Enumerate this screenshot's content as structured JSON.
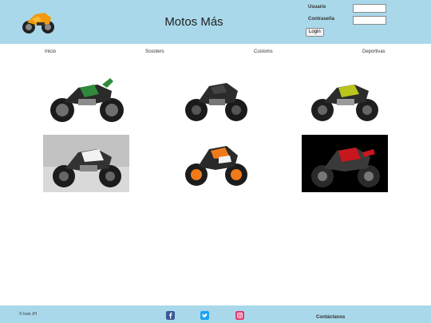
{
  "header": {
    "title": "Motos Más",
    "logo_icon": "orange-sport-motorcycle-logo",
    "login": {
      "user_label": "Usuario",
      "password_label": "Contraseña",
      "user_value": "",
      "password_value": "",
      "button_label": "Login"
    }
  },
  "nav": {
    "items": [
      {
        "label": "Inicio"
      },
      {
        "label": "Scooters"
      },
      {
        "label": "Customs"
      },
      {
        "label": "Deportivas"
      }
    ]
  },
  "gallery": {
    "items": [
      {
        "name": "green-naked-motorcycle",
        "accent": "#2f8a3c"
      },
      {
        "name": "black-naked-motorcycle",
        "accent": "#2b2b2b"
      },
      {
        "name": "lime-naked-motorcycle",
        "accent": "#b9c41c"
      },
      {
        "name": "white-naked-motorcycle",
        "accent": "#e6e6e6"
      },
      {
        "name": "orange-white-sport-motorcycle",
        "accent": "#f07a1a"
      },
      {
        "name": "red-supermoto-motorcycle",
        "accent": "#c8161d"
      }
    ]
  },
  "footer": {
    "copyright": "© Ivan JH",
    "contact_label": "Contáctanos",
    "social_icons": [
      "facebook-icon",
      "twitter-icon",
      "instagram-icon"
    ]
  },
  "colors": {
    "header_bg": "#a9d8ea",
    "footer_bg": "#a9d8ea",
    "facebook": "#3b5998",
    "twitter": "#1da1f2",
    "instagram": "#e1306c"
  }
}
